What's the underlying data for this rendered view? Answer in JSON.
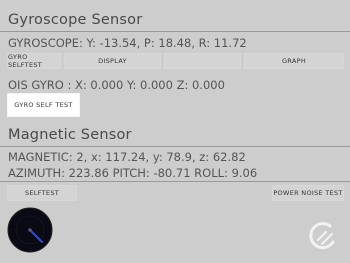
{
  "gyroscope": {
    "title": "Gyroscope Sensor",
    "readout": "GYROSCOPE: Y: -13.54, P: 18.48, R: 11.72",
    "buttons": {
      "selftest": "GYRO SELFTEST",
      "display": "DISPLAY",
      "graph": "GRAPH"
    },
    "ois_readout": "OIS GYRO : X: 0.000 Y: 0.000 Z: 0.000",
    "ois_button": "GYRO SELF TEST"
  },
  "magnetic": {
    "title": "Magnetic Sensor",
    "readout": "MAGNETIC: 2, x: 117.24, y: 78.9, z: 62.82",
    "azimuth_readout": "AZIMUTH: 223.86  PITCH: -80.71  ROLL: 9.06",
    "buttons": {
      "selftest": "SELFTEST",
      "power_noise": "POWER NOISE TEST"
    }
  },
  "icons": {
    "compass": "compass-radar-icon",
    "logo": "app-logo-icon"
  },
  "colors": {
    "background": "#cdcdcd",
    "text": "#4a4a4a",
    "active_button": "#ffffff",
    "radar_fill": "#0a0a14",
    "radar_needle": "#2d4fd6"
  }
}
